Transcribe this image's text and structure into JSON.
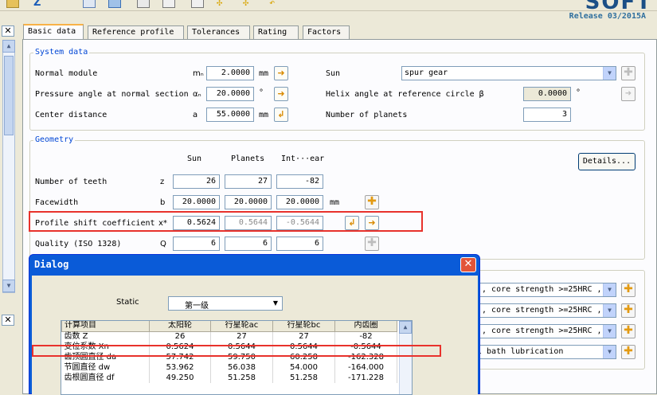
{
  "header": {
    "release": "Release 03/2015A",
    "logo_text": "SOFT"
  },
  "tabs": [
    {
      "label": "Basic data",
      "active": true
    },
    {
      "label": "Reference profile",
      "active": false
    },
    {
      "label": "Tolerances",
      "active": false
    },
    {
      "label": "Rating",
      "active": false
    },
    {
      "label": "Factors",
      "active": false
    }
  ],
  "system_data": {
    "title": "System data",
    "normal_module": {
      "label": "Normal module",
      "symbol": "mₙ",
      "value": "2.0000",
      "unit": "mm"
    },
    "pressure_angle": {
      "label": "Pressure angle at normal section",
      "symbol": "αₙ",
      "value": "20.0000",
      "unit": "°"
    },
    "center_distance": {
      "label": "Center distance",
      "symbol": "a",
      "value": "55.0000",
      "unit": "mm"
    },
    "sun": {
      "label": "Sun",
      "value": "spur gear"
    },
    "helix_angle": {
      "label": "Helix angle at reference circle β",
      "value": "0.0000",
      "unit": "°"
    },
    "num_planets": {
      "label": "Number of planets",
      "value": "3"
    }
  },
  "geometry": {
    "title": "Geometry",
    "col_sun": "Sun",
    "col_planets": "Planets",
    "col_int": "Int···ear",
    "details_button": "Details...",
    "teeth": {
      "label": "Number of teeth",
      "symbol": "z",
      "sun": "26",
      "planets": "27",
      "int": "-82"
    },
    "facewidth": {
      "label": "Facewidth",
      "symbol": "b",
      "sun": "20.0000",
      "planets": "20.0000",
      "int": "20.0000",
      "unit": "mm"
    },
    "profile_shift": {
      "label": "Profile shift coefficient",
      "symbol": "x*",
      "sun": "0.5624",
      "planets": "0.5644",
      "int": "-0.5644"
    },
    "quality": {
      "label": "Quality (ISO 1328)",
      "symbol": "Q",
      "sun": "6",
      "planets": "6",
      "int": "6"
    }
  },
  "right_rows": [
    "), core strength >=25HRC ,",
    "), core strength >=25HRC ,",
    "), core strength >=25HRC ,",
    "l bath lubrication"
  ],
  "dialog": {
    "title": "Dialog",
    "static_label": "Static",
    "static_value": "第一级",
    "columns": [
      "计算项目",
      "太阳轮",
      "行星轮ac",
      "行星轮bc",
      "内齿圈"
    ],
    "rows": [
      [
        "齿数 Z",
        "26",
        "27",
        "27",
        "-82"
      ],
      [
        "变位系数 Xn",
        "0.5624",
        "0.5644",
        "0.5644",
        "-0.5644"
      ],
      [
        "齿顶圆直径 da",
        "57.742",
        "59.750",
        "60.258",
        "-162.328"
      ],
      [
        "节圆直径 dw",
        "53.962",
        "56.038",
        "54.000",
        "-164.000"
      ],
      [
        "齿根圆直径 df",
        "49.250",
        "51.258",
        "51.258",
        "-171.228"
      ]
    ]
  }
}
